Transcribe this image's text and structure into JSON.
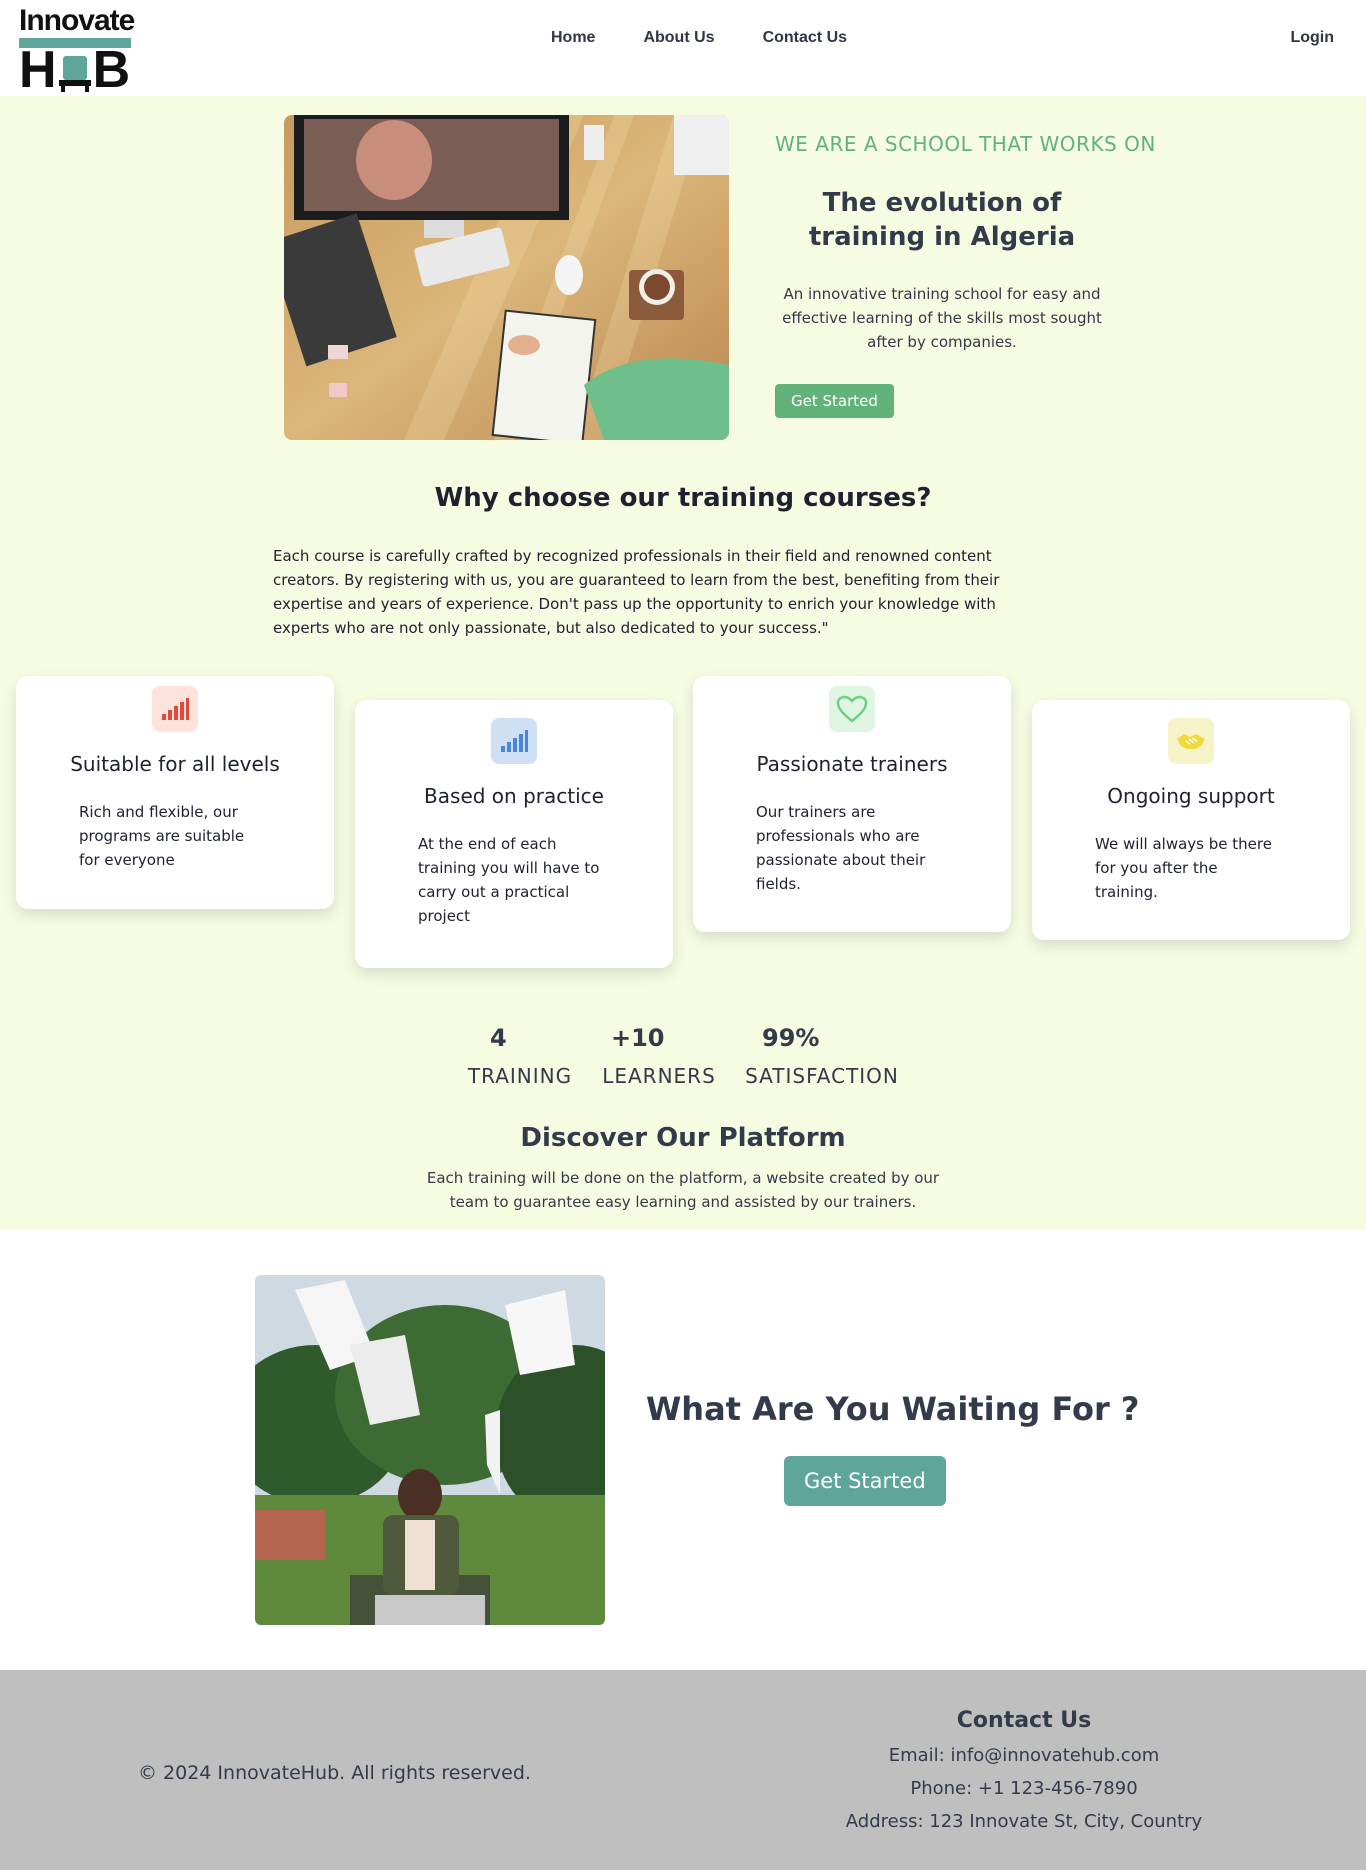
{
  "brand": {
    "logo_top": "Innovate",
    "logo_h": "H",
    "logo_b": "B"
  },
  "nav": {
    "links": [
      "Home",
      "About Us",
      "Contact Us"
    ],
    "login": "Login"
  },
  "hero": {
    "eyebrow": "WE ARE A SCHOOL THAT WORKS ON",
    "title": "The evolution of training in Algeria",
    "description": "An innovative training school for easy and effective learning of the skills most sought after by companies.",
    "cta": "Get Started"
  },
  "why": {
    "title": "Why choose our training courses?",
    "description": "Each course is carefully crafted by recognized professionals in their field and renowned content creators. By registering with us, you are guaranteed to learn from the best, benefiting from their expertise and years of experience. Don't pass up the opportunity to enrich your knowledge with experts who are not only passionate, but also dedicated to your success.\"",
    "cards": [
      {
        "title": "Suitable for all levels",
        "desc": "Rich and flexible, our programs are suitable for everyone",
        "icon": "signal-bars-icon",
        "icon_color": "#e04a3a",
        "icon_bg": "#fde3dc"
      },
      {
        "title": "Based on practice",
        "desc": "At the end of each training you will have to carry out a practical project",
        "icon": "signal-bars-icon",
        "icon_color": "#4a86d8",
        "icon_bg": "#cfe0f5"
      },
      {
        "title": "Passionate trainers",
        "desc": "Our trainers are professionals who are passionate about their fields.",
        "icon": "heart-icon",
        "icon_color": "#6ccf8a",
        "icon_bg": "#dff5e2"
      },
      {
        "title": "Ongoing support",
        "desc": "We will always be there for you after the training.",
        "icon": "handshake-icon",
        "icon_color": "#f2d93a",
        "icon_bg": "#f7f3c8"
      }
    ]
  },
  "stats": [
    {
      "num": "4",
      "label": "TRAINING"
    },
    {
      "num": "+10",
      "label": "LEARNERS"
    },
    {
      "num": "99%",
      "label": "SATISFACTION"
    }
  ],
  "discover": {
    "title": "Discover Our Platform",
    "description": "Each training will be done on the platform, a website created by our team to guarantee easy learning and assisted by our trainers."
  },
  "cta": {
    "title": "What Are You Waiting For ?",
    "button": "Get Started"
  },
  "footer": {
    "copyright": "© 2024 InnovateHub. All rights reserved.",
    "contact_title": "Contact Us",
    "email": "Email: info@innovatehub.com",
    "phone": "Phone: +1 123-456-7890",
    "address": "Address: 123 Innovate St, City, Country"
  },
  "colors": {
    "cream": "#f5fce2",
    "green": "#62b37a",
    "teal": "#5ea69a",
    "footer": "#bfbfbf"
  }
}
